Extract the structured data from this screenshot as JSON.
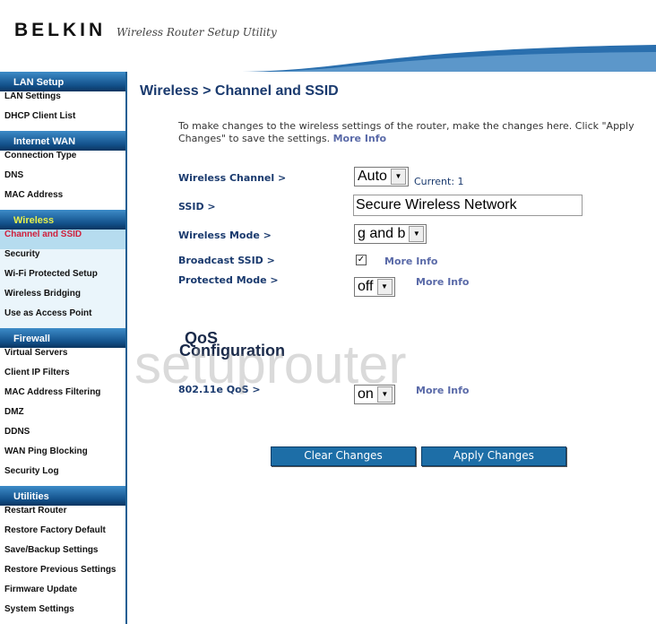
{
  "header": {
    "brand": "BELKIN",
    "tagline": "Wireless Router Setup Utility"
  },
  "sidebar": [
    {
      "section": "LAN Setup",
      "items": [
        "LAN Settings",
        "DHCP Client List"
      ]
    },
    {
      "section": "Internet WAN",
      "items": [
        "Connection Type",
        "DNS",
        "MAC Address"
      ]
    },
    {
      "section": "Wireless",
      "active": true,
      "items": [
        "Channel and SSID",
        "Security",
        "Wi-Fi Protected Setup",
        "Wireless Bridging",
        "Use as Access Point"
      ]
    },
    {
      "section": "Firewall",
      "items": [
        "Virtual Servers",
        "Client IP Filters",
        "MAC Address Filtering",
        "DMZ",
        "DDNS",
        "WAN Ping Blocking",
        "Security Log"
      ]
    },
    {
      "section": "Utilities",
      "items": [
        "Restart Router",
        "Restore Factory Default",
        "Save/Backup Settings",
        "Restore Previous Settings",
        "Firmware Update",
        "System Settings"
      ]
    }
  ],
  "main": {
    "title": "Wireless > Channel and SSID",
    "intro": "To make changes to the wireless settings of the router, make the changes here. Click \"Apply Changes\" to save the settings.",
    "more_info": "More Info",
    "channel_label": "Wireless Channel >",
    "channel_value": "Auto",
    "current": "Current: 1",
    "ssid_label": "SSID >",
    "ssid_value": "Secure Wireless Network",
    "mode_label": "Wireless Mode >",
    "mode_value": "g and b",
    "broadcast_label": "Broadcast SSID >",
    "broadcast_checked": true,
    "protected_label": "Protected Mode >",
    "protected_value": "off",
    "qos_heading_1": "QoS",
    "qos_heading_2": "Configuration",
    "qos_label": "802.11e QoS >",
    "qos_value": "on",
    "clear": "Clear Changes",
    "apply": "Apply Changes"
  },
  "watermark": "setuprouter"
}
